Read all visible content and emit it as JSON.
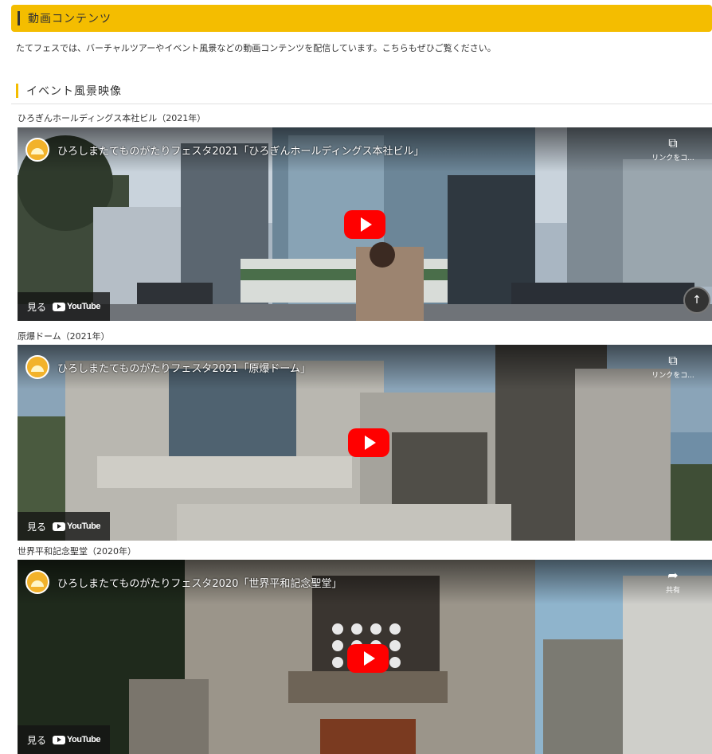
{
  "section": {
    "title": "動画コンテンツ"
  },
  "intro": {
    "text": "たてフェスでは、バーチャルツアーやイベント風景などの動画コンテンツを配信しています。こちらもぜひご覧ください。"
  },
  "subsection": {
    "title": "イベント風景映像"
  },
  "youtube": {
    "watch_label": "見る",
    "logo_text": "YouTube"
  },
  "videos": [
    {
      "label": "ひろぎんホールディングス本社ビル（2021年）",
      "title": "ひろしまたてものがたりフェスタ2021「ひろぎんホールディングス本社ビル」",
      "action_icon": "copy-link-icon",
      "action_label": "リンクをコ..."
    },
    {
      "label": "原爆ドーム（2021年）",
      "title": "ひろしまたてものがたりフェスタ2021「原爆ドーム」",
      "action_icon": "copy-link-icon",
      "action_label": "リンクをコ..."
    },
    {
      "label": "世界平和記念聖堂（2020年）",
      "title": "ひろしまたてものがたりフェスタ2020「世界平和記念聖堂」",
      "action_icon": "share-icon",
      "action_label": "共有"
    }
  ],
  "colors": {
    "accent": "#f4bd00",
    "youtube_red": "#ff0000"
  }
}
